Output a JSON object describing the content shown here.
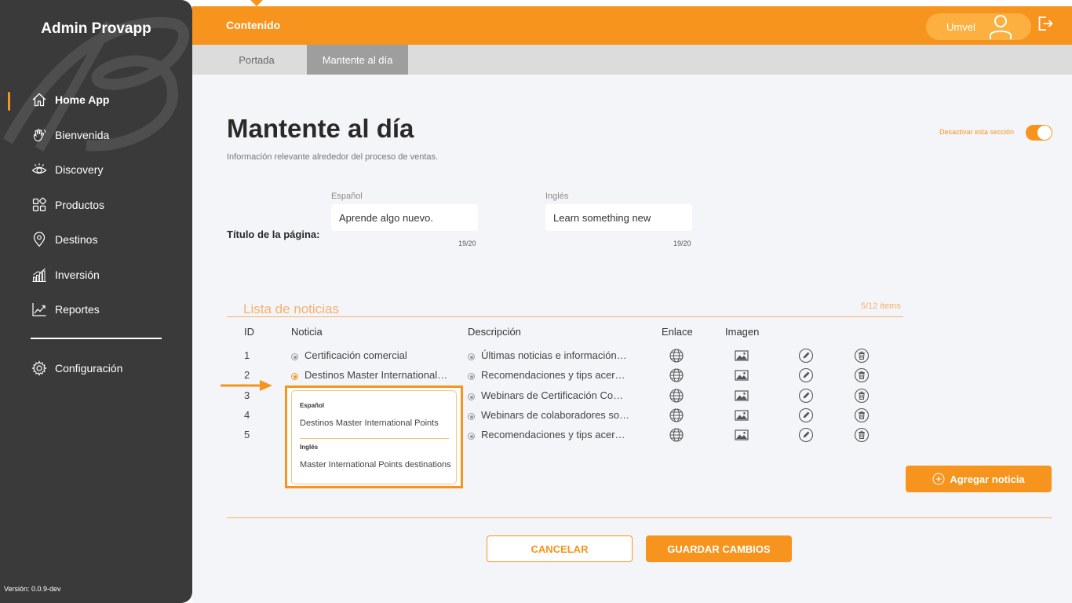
{
  "sidebar": {
    "title": "Admin Provapp",
    "items": [
      {
        "label": "Home App",
        "icon": "home-icon",
        "active": true
      },
      {
        "label": "Bienvenida",
        "icon": "waving-hand-icon"
      },
      {
        "label": "Discovery",
        "icon": "eye-icon"
      },
      {
        "label": "Productos",
        "icon": "grid-icon"
      },
      {
        "label": "Destinos",
        "icon": "map-pin-icon"
      },
      {
        "label": "Inversión",
        "icon": "bar-chart-icon"
      },
      {
        "label": "Reportes",
        "icon": "line-chart-icon"
      }
    ],
    "config": {
      "label": "Configuración",
      "icon": "gear-icon"
    },
    "version": "Versión: 0.0.9-dev"
  },
  "header": {
    "title": "Contenido",
    "user": "Umvel"
  },
  "tabs": [
    {
      "label": "Portada"
    },
    {
      "label": "Mantente al día",
      "active": true
    }
  ],
  "page": {
    "title": "Mantente al día",
    "subtitle": "Información relevante alrededor del proceso de ventas.",
    "toggle_label": "Desactivar esta sección",
    "toggle_on": true
  },
  "form": {
    "row_label": "Título de la página:",
    "spanish": {
      "label": "Español",
      "value": "Aprende algo nuevo.",
      "count": "19/20"
    },
    "english": {
      "label": "Inglés",
      "value": "Learn something new",
      "count": "19/20"
    }
  },
  "news": {
    "title": "Lista de noticias",
    "count": "5/12 items",
    "columns": {
      "id": "ID",
      "noticia": "Noticia",
      "descripcion": "Descripción",
      "enlace": "Enlace",
      "imagen": "Imagen"
    },
    "rows": [
      {
        "id": "1",
        "noticia": "Certificación comercial",
        "descripcion": "Últimas noticias e información…"
      },
      {
        "id": "2",
        "noticia": "Destinos Master International …",
        "descripcion": "Recomendaciones y tips acer…",
        "active": true
      },
      {
        "id": "3",
        "noticia": "",
        "descripcion": "Webinars de Certificación Co…"
      },
      {
        "id": "4",
        "noticia": "",
        "descripcion": "Webinars de colaboradores so…"
      },
      {
        "id": "5",
        "noticia": "",
        "descripcion": "Recomendaciones y tips acer…"
      }
    ],
    "tooltip": {
      "es_label": "Español",
      "es_value": "Destinos Master International Points",
      "en_label": "Inglés",
      "en_value": "Master International Points destinations"
    },
    "add_label": "Agregar noticia"
  },
  "actions": {
    "cancel": "CANCELAR",
    "save": "GUARDAR CAMBIOS"
  },
  "colors": {
    "accent": "#f7941d",
    "sidebar": "#3a3a3a",
    "content_bg": "#f4f5f9"
  }
}
